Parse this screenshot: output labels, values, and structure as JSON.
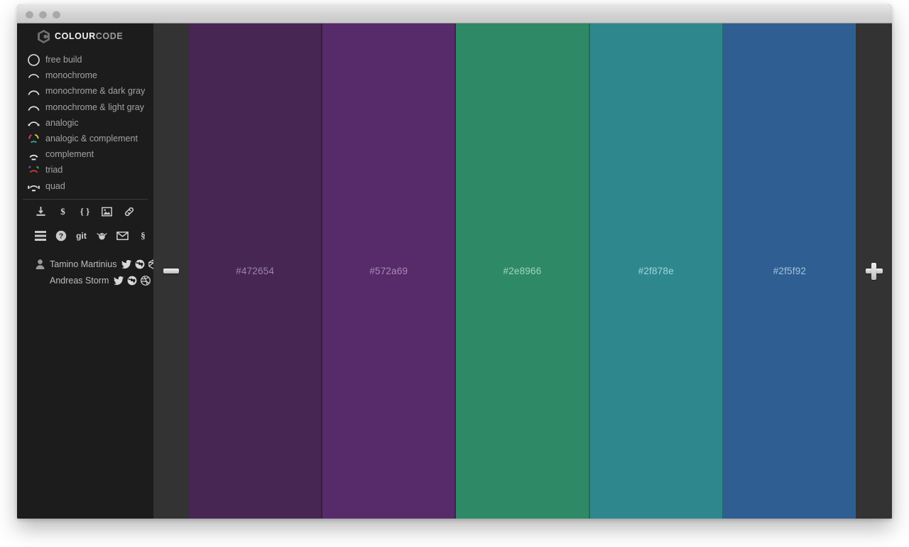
{
  "window": {
    "traffic_lights": [
      "close",
      "minimize",
      "maximize"
    ]
  },
  "sidebar": {
    "logo": {
      "bold": "COLOUR",
      "light": "CODE",
      "mark": "colourcode-hex-logo"
    },
    "modes": [
      {
        "label": "free build",
        "icon": "circle-full-icon"
      },
      {
        "label": "monochrome",
        "icon": "arc-monochrome-icon"
      },
      {
        "label": "monochrome & dark gray",
        "icon": "arc-monochrome-dark-gray-icon"
      },
      {
        "label": "monochrome & light gray",
        "icon": "arc-monochrome-light-gray-icon"
      },
      {
        "label": "analogic",
        "icon": "arc-analogic-icon"
      },
      {
        "label": "analogic & complement",
        "icon": "arc-analogic-complement-icon"
      },
      {
        "label": "complement",
        "icon": "arc-complement-icon"
      },
      {
        "label": "triad",
        "icon": "arc-triad-icon"
      },
      {
        "label": "quad",
        "icon": "arc-quad-icon"
      }
    ],
    "tools_row_1": [
      {
        "name": "download-icon",
        "title": "download"
      },
      {
        "name": "sass-icon",
        "title": "sass"
      },
      {
        "name": "css-braces-icon",
        "title": "css"
      },
      {
        "name": "image-icon",
        "title": "image"
      },
      {
        "name": "link-icon",
        "title": "permalink"
      }
    ],
    "tools_row_2": [
      {
        "name": "hamburger-menu-icon",
        "title": "menu"
      },
      {
        "name": "help-question-icon",
        "title": "help"
      },
      {
        "name": "git-icon",
        "title": "git",
        "text": "git"
      },
      {
        "name": "bug-icon",
        "title": "issues"
      },
      {
        "name": "mail-icon",
        "title": "mail"
      },
      {
        "name": "imprint-section-icon",
        "title": "imprint",
        "text": "§"
      }
    ],
    "authors": [
      {
        "name": "Tamino Martinius",
        "socials": [
          "twitter-icon",
          "globe-icon",
          "codepen-icon"
        ]
      },
      {
        "name": "Andreas Storm",
        "socials": [
          "twitter-icon",
          "globe-icon",
          "dribbble-icon"
        ]
      }
    ]
  },
  "main": {
    "remove_button": {
      "name": "remove-swatch-button",
      "icon": "minus-icon"
    },
    "add_button": {
      "name": "add-swatch-button",
      "icon": "plus-icon"
    },
    "swatches": [
      {
        "hex": "#472654",
        "label": "#472654",
        "text_color": "#9b85a8"
      },
      {
        "hex": "#572a69",
        "label": "#572a69",
        "text_color": "#a78cb5"
      },
      {
        "hex": "#2e8966",
        "label": "#2e8966",
        "text_color": "#9fd8bf"
      },
      {
        "hex": "#2f878e",
        "label": "#2f878e",
        "text_color": "#9fd6da"
      },
      {
        "hex": "#2f5f92",
        "label": "#2f5f92",
        "text_color": "#a6c2de"
      }
    ]
  }
}
